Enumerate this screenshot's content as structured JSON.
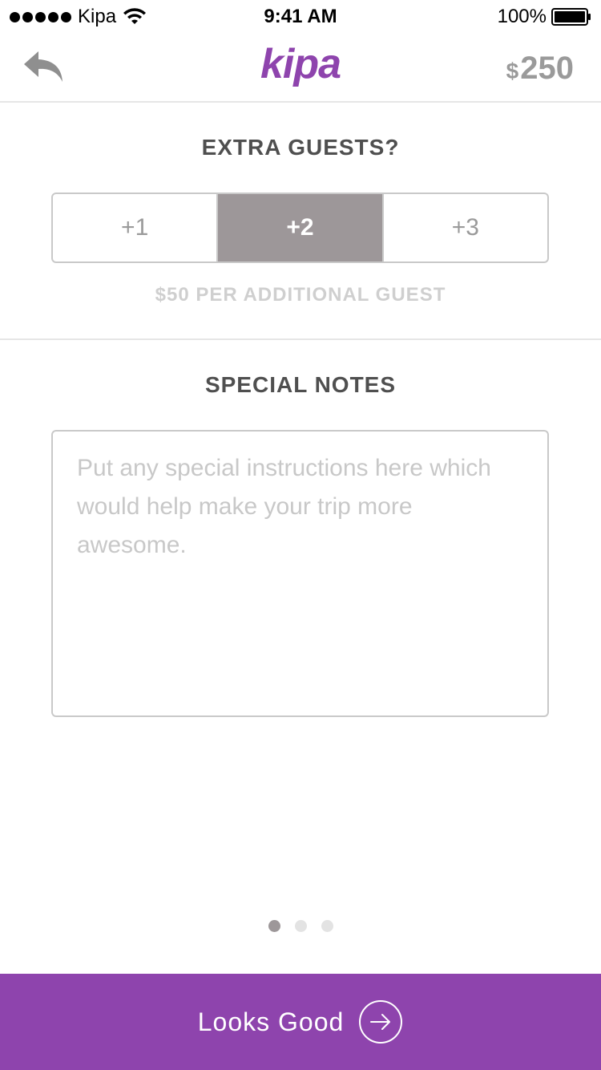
{
  "status_bar": {
    "carrier": "Kipa",
    "time": "9:41 AM",
    "battery": "100%"
  },
  "nav": {
    "logo": "kipa",
    "price_currency": "$",
    "price_amount": "250",
    "back_icon": "reply-arrow-icon"
  },
  "guests": {
    "title": "EXTRA GUESTS?",
    "options": [
      "+1",
      "+2",
      "+3"
    ],
    "selected": "+2",
    "note": "$50 PER ADDITIONAL GUEST"
  },
  "notes": {
    "title": "SPECIAL NOTES",
    "placeholder": "Put any special instructions here which would help make your trip more awesome.",
    "value": ""
  },
  "pager": {
    "total": 3,
    "current": 1
  },
  "footer": {
    "label": "Looks Good",
    "icon": "arrow-right-circle-icon"
  },
  "colors": {
    "brand": "#8e44ad",
    "segment_active": "#9d9799",
    "muted_text": "#9a9a9a"
  }
}
